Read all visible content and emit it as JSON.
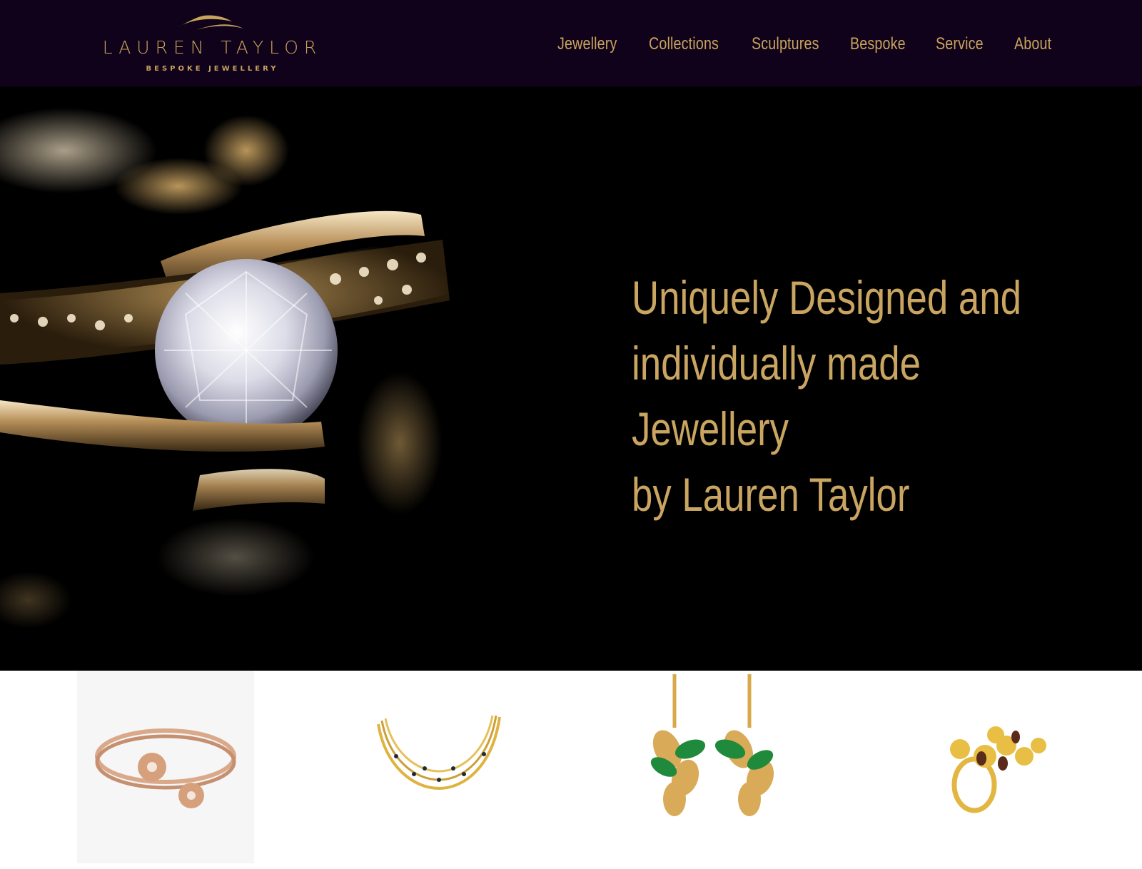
{
  "brand": {
    "name": "LAUREN TAYLOR",
    "tagline": "BESPOKE JEWELLERY",
    "accent_color": "#c7a35c",
    "header_bg": "#10021b"
  },
  "nav": {
    "items": [
      {
        "label": "Jewellery"
      },
      {
        "label": "Collections"
      },
      {
        "label": "Sculptures"
      },
      {
        "label": "Bespoke"
      },
      {
        "label": "Service"
      },
      {
        "label": "About"
      }
    ]
  },
  "hero": {
    "headline_lines": [
      "Uniquely Designed and",
      "individually made Jewellery",
      "by Lauren Taylor"
    ],
    "image_icon": "diamond-ring-photo"
  },
  "products": [
    {
      "icon": "bangle-bracelet-image"
    },
    {
      "icon": "gold-necklace-image"
    },
    {
      "icon": "leaf-earrings-image"
    },
    {
      "icon": "flower-ring-image"
    }
  ]
}
